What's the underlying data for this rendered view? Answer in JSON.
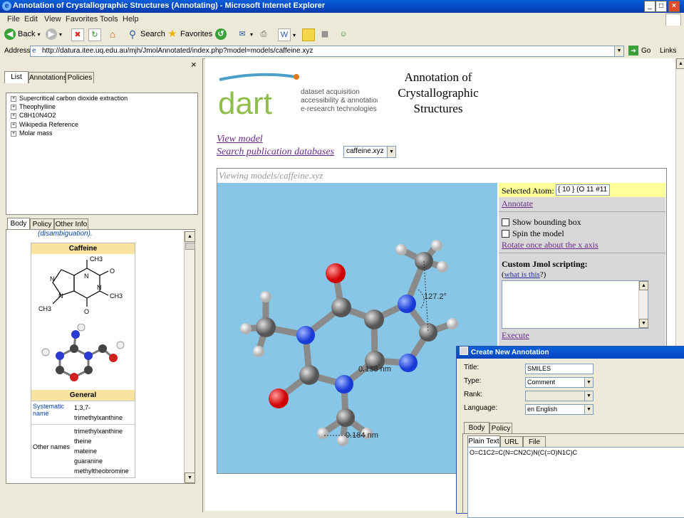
{
  "window": {
    "title": "Annotation of Crystallographic Structures (Annotating) - Microsoft Internet Explorer",
    "min": "_",
    "max": "□",
    "close": "×"
  },
  "menu": [
    "File",
    "Edit",
    "View",
    "Favorites",
    "Tools",
    "Help"
  ],
  "toolbar": {
    "back": "Back",
    "search": "Search",
    "favorites": "Favorites"
  },
  "address": {
    "label": "Address",
    "url": "http://datura.itee.uq.edu.au/mjh/JmolAnnotated/index.php?model=models/caffeine.xyz",
    "go": "Go",
    "links": "Links"
  },
  "left_panel": {
    "top_tabs": [
      "List",
      "Annotations",
      "Policies"
    ],
    "tree": [
      "Supercritical carbon dioxide extraction",
      "Theophylline",
      "C8H10N4O2",
      "Wikipedia Reference",
      "Molar mass"
    ],
    "bottom_tabs": [
      "Body",
      "Policy",
      "Other Info"
    ],
    "wiki": {
      "disamb": "(disambiguation).",
      "name": "Caffeine",
      "general": "General",
      "rows": [
        {
          "k": "Systematic name",
          "v": "1,3,7-trimethylxanthine"
        },
        {
          "k": "Other names",
          "v": "trimethylxanthine theine mateine guaranine methyltheobromine"
        }
      ],
      "struct_labels": {
        "ch3": "CH3",
        "n": "N",
        "o": "O"
      }
    }
  },
  "content": {
    "logo_word": "dart",
    "logo_tag": [
      "dataset acquisition",
      "accessibility & annotation",
      "e-research technologies"
    ],
    "title": [
      "Annotation of",
      "Crystallographic",
      "Structures"
    ],
    "view_model": "View model",
    "search_pub": "Search publication databases",
    "model_select": "caffeine.xyz",
    "viewing": "Viewing models/caffeine.xyz",
    "measure_angle": "127.2°",
    "measure_d1": "0.138 nm",
    "measure_d2": "0.184 nm",
    "selected_atom_label": "Selected Atom:",
    "selected_atom_value": "{ 10 } (O 11 #11",
    "annotate": "Annotate",
    "show_bbox": "Show bounding box",
    "spin": "Spin the model",
    "rotate": "Rotate once about the x axis",
    "custom_title": "Custom Jmol scripting:",
    "what_is_this": "what is this",
    "execute": "Execute"
  },
  "dialog": {
    "title": "Create New Annotation",
    "fields": {
      "title_label": "Title:",
      "title_value": "SMILES",
      "type_label": "Type:",
      "type_value": "Comment",
      "rank_label": "Rank:",
      "lang_label": "Language:",
      "lang_value": "en English"
    },
    "tabs": [
      "Body",
      "Policy"
    ],
    "subtabs": [
      "Plain Text",
      "URL",
      "File"
    ],
    "body_text": "O=C1C2=C(N=CN2C)N(C(=O)N1C)C"
  },
  "colors": {
    "titlebar": "#0346c0",
    "jmol_bg": "#87c6e6",
    "infobox_head": "#f8e4a0",
    "link": "#6a2a8a",
    "dart_green": "#8fbf4a"
  }
}
